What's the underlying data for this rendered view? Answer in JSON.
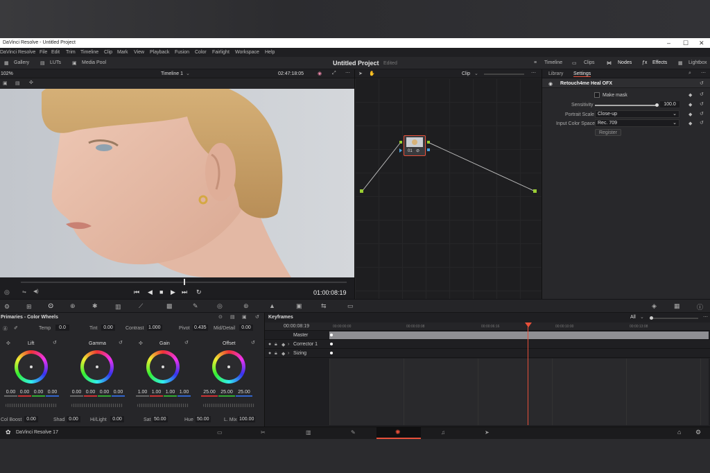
{
  "window": {
    "title": "DaVinci Resolve - Untitled Project"
  },
  "menu": [
    "DaVinci Resolve",
    "File",
    "Edit",
    "Trim",
    "Timeline",
    "Clip",
    "Mark",
    "View",
    "Playback",
    "Fusion",
    "Color",
    "Fairlight",
    "Workspace",
    "Help"
  ],
  "toolbar": {
    "left": [
      "Gallery",
      "LUTs",
      "Media Pool"
    ],
    "project_title": "Untitled Project",
    "edited": "Edited",
    "right": [
      "Timeline",
      "Clips",
      "Nodes",
      "Effects",
      "Lightbox"
    ]
  },
  "viewer": {
    "zoom": "102%",
    "timeline": "Timeline 1",
    "timecode_top": "02:47:18:05",
    "timecode_bottom": "01:00:08:19"
  },
  "node_editor": {
    "mode": "Clip",
    "node_label": "01"
  },
  "inspector": {
    "tabs": [
      "Library",
      "Settings"
    ],
    "active_tab": "Settings",
    "plugin": "Retouch4me Heal OFX",
    "make_mask": "Make mask",
    "sensitivity_label": "Sensitivity",
    "sensitivity_value": "100.0",
    "sensitivity_fraction": 1.0,
    "portrait_scale_label": "Portrait Scale",
    "portrait_scale_value": "Close-up",
    "input_color_space_label": "Input Color Space",
    "input_color_space_value": "Rec. 709",
    "register": "Register"
  },
  "color_wheels": {
    "title": "Primaries - Color Wheels",
    "temp_label": "Temp",
    "temp": "0.0",
    "tint_label": "Tint",
    "tint": "0.00",
    "contrast_label": "Contrast",
    "contrast": "1.000",
    "pivot_label": "Pivot",
    "pivot": "0.435",
    "middetail_label": "Mid/Detail",
    "middetail": "0.00",
    "wheels": [
      {
        "name": "Lift",
        "values": [
          "0.00",
          "0.00",
          "0.00",
          "0.00"
        ]
      },
      {
        "name": "Gamma",
        "values": [
          "0.00",
          "0.00",
          "0.00",
          "0.00"
        ]
      },
      {
        "name": "Gain",
        "values": [
          "1.00",
          "1.00",
          "1.00",
          "1.00"
        ]
      },
      {
        "name": "Offset",
        "values": [
          "25.00",
          "25.00",
          "25.00"
        ]
      }
    ],
    "colboost_label": "Col Boost",
    "colboost": "0.00",
    "shad_label": "Shad",
    "shad": "0.00",
    "hilight_label": "Hi/Light",
    "hilight": "0.00",
    "sat_label": "Sat",
    "sat": "50.00",
    "hue_label": "Hue",
    "hue": "50.00",
    "lmix_label": "L. Mix",
    "lmix": "100.00"
  },
  "keyframes": {
    "title": "Keyframes",
    "filter": "All",
    "timecode": "00:00:08:19",
    "ruler": [
      "00:00:00:00",
      "00:00:03:08",
      "00:00:06:16",
      "00:00:10:00",
      "00:00:13:08"
    ],
    "rows": [
      "Master",
      "Corrector 1",
      "Sizing"
    ]
  },
  "footer": {
    "app": "DaVinci Resolve 17"
  },
  "colors": {
    "accent": "#e8503a",
    "node_green": "#9acd32"
  }
}
